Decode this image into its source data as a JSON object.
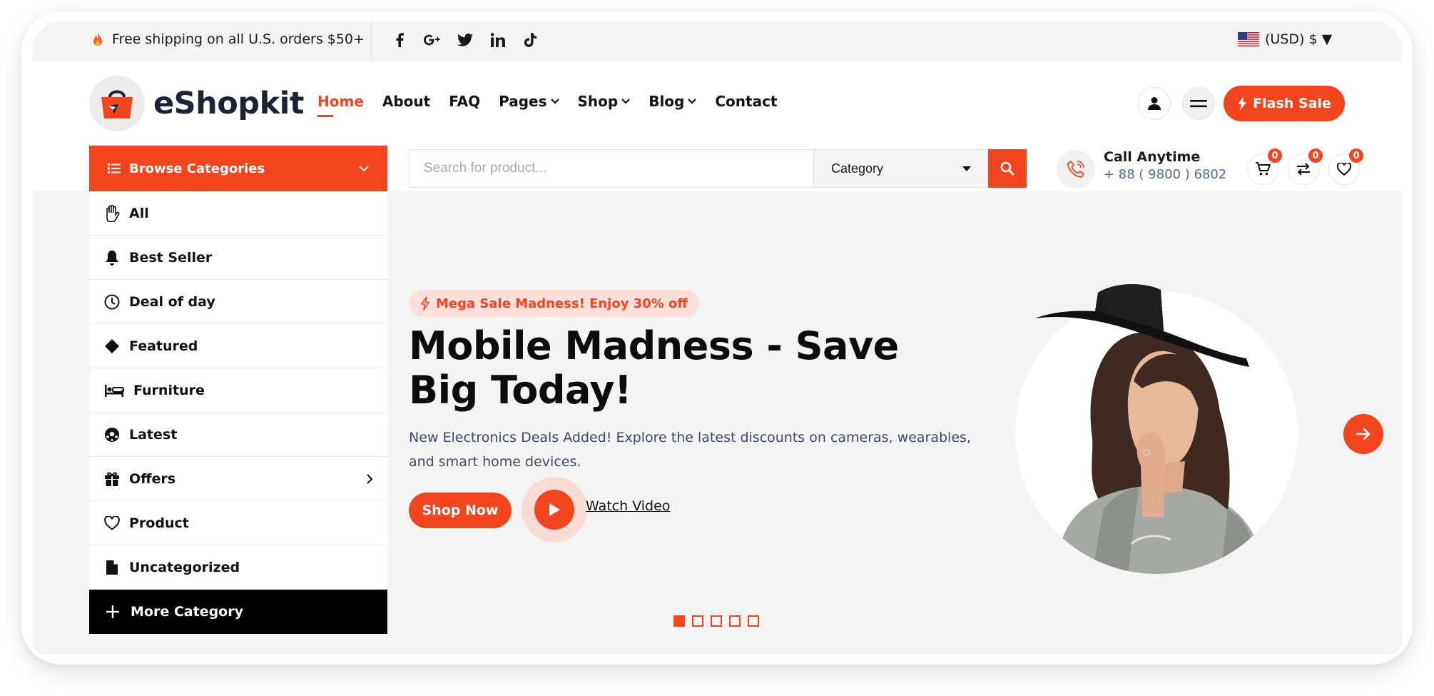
{
  "topbar": {
    "shipping_text": "Free shipping on all U.S. orders $50+",
    "socials": [
      "facebook-icon",
      "google-plus-icon",
      "twitter-icon",
      "linkedin-icon",
      "tiktok-icon"
    ],
    "currency": "(USD) $ ▼"
  },
  "header": {
    "logo_text": "eShopkit",
    "nav": [
      {
        "label": "Home",
        "active": true
      },
      {
        "label": "About"
      },
      {
        "label": "FAQ"
      },
      {
        "label": "Pages",
        "dropdown": true
      },
      {
        "label": "Shop",
        "dropdown": true
      },
      {
        "label": "Blog",
        "dropdown": true
      },
      {
        "label": "Contact"
      }
    ],
    "flash_sale_label": "Flash Sale"
  },
  "categories": {
    "browse_label": "Browse Categories",
    "items": [
      {
        "label": "All",
        "icon": "hand-icon"
      },
      {
        "label": "Best Seller",
        "icon": "bell-icon"
      },
      {
        "label": "Deal of day",
        "icon": "clock-icon"
      },
      {
        "label": "Featured",
        "icon": "diamond-icon"
      },
      {
        "label": "Furniture",
        "icon": "bed-icon"
      },
      {
        "label": "Latest",
        "icon": "football-icon"
      },
      {
        "label": "Offers",
        "icon": "gift-icon",
        "has_submenu": true
      },
      {
        "label": "Product",
        "icon": "heart-icon"
      },
      {
        "label": "Uncategorized",
        "icon": "file-icon"
      }
    ],
    "more_label": "More Category"
  },
  "search": {
    "placeholder": "Search for product...",
    "category_label": "Category"
  },
  "contact": {
    "title": "Call Anytime",
    "phone": "+ 88 ( 9800 ) 6802"
  },
  "counters": {
    "cart": "0",
    "compare": "0",
    "wishlist": "0"
  },
  "hero": {
    "promo": "Mega Sale Madness! Enjoy 30% off",
    "title": "Mobile Madness - Save Big Today!",
    "description": "New Electronics Deals Added! Explore the latest discounts on cameras, wearables, and smart home devices.",
    "shop_label": "Shop Now",
    "watch_label": "Watch Video",
    "slide_count": 5,
    "active_slide": 1
  },
  "colors": {
    "accent": "#f2451e",
    "dark": "#1c2433",
    "hero_bg": "#f4f4f4"
  }
}
